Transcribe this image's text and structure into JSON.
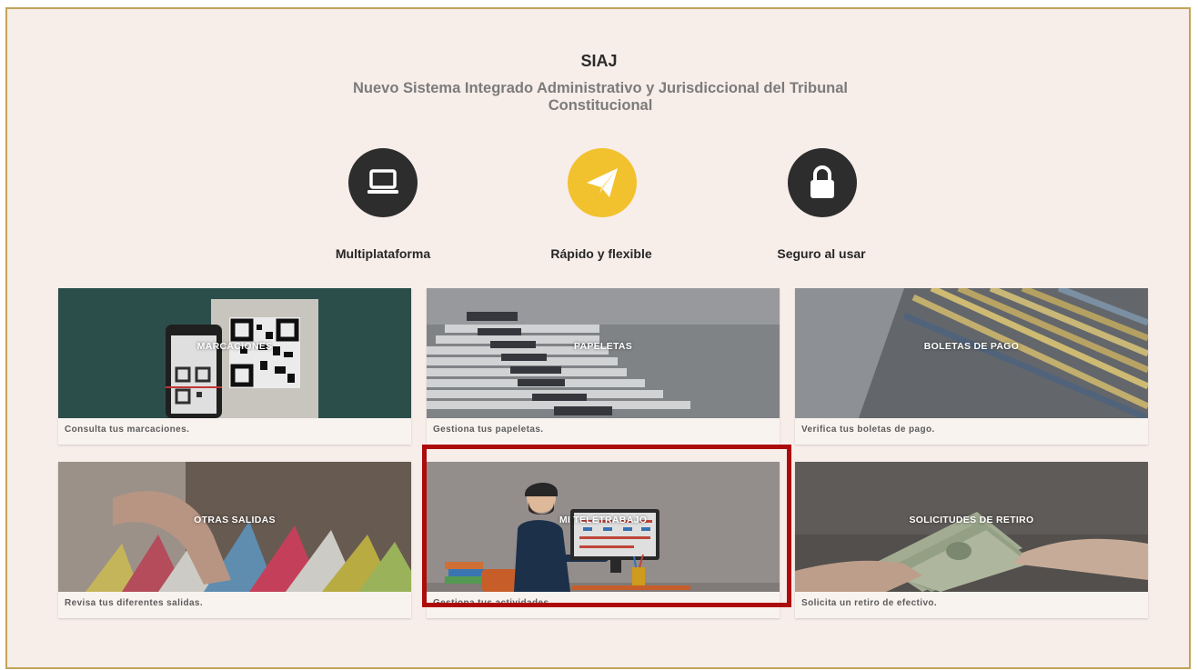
{
  "header": {
    "title": "SIAJ",
    "subtitle": "Nuevo Sistema Integrado Administrativo y Jurisdiccional del Tribunal Constitucional"
  },
  "features": [
    {
      "label": "Multiplataforma",
      "icon": "laptop-icon",
      "color": "#2d2d2d"
    },
    {
      "label": "Rápido y flexible",
      "icon": "paper-plane-icon",
      "color": "#f2c12e"
    },
    {
      "label": "Seguro al usar",
      "icon": "lock-icon",
      "color": "#2d2d2d"
    }
  ],
  "cards": [
    {
      "title": "MARCACIONES",
      "description": "Consulta tus marcaciones."
    },
    {
      "title": "PAPELETAS",
      "description": "Gestiona tus papeletas."
    },
    {
      "title": "BOLETAS DE PAGO",
      "description": "Verifica tus boletas de pago."
    },
    {
      "title": "OTRAS SALIDAS",
      "description": "Revisa tus diferentes salidas."
    },
    {
      "title": "MI TELETRABAJO",
      "description": "Gestiona tus actividades."
    },
    {
      "title": "SOLICITUDES DE RETIRO",
      "description": "Solicita un retiro de efectivo."
    }
  ],
  "highlight_color": "#ad0b0b"
}
